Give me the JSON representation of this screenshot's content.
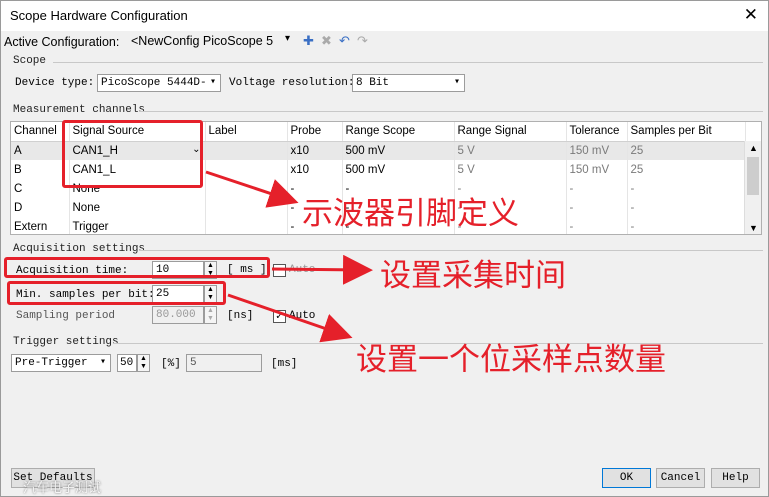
{
  "window": {
    "title": "Scope Hardware Configuration",
    "close": "✕"
  },
  "active_config": {
    "label": "Active Configuration:",
    "value": "<NewConfig PicoScope 5"
  },
  "scope": {
    "group": "Scope",
    "device_type_label": "Device type:",
    "device_type_value": "PicoScope  5444D-",
    "voltage_res_label": "Voltage resolution:",
    "voltage_res_value": "8 Bit"
  },
  "channels": {
    "group": "Measurement channels",
    "headers": [
      "Channel",
      "Signal Source",
      "Label",
      "Probe",
      "Range Scope",
      "Range Signal",
      "Tolerance",
      "Samples per Bit"
    ],
    "rows": [
      [
        "A",
        "CAN1_H",
        "",
        "x10",
        "500 mV",
        "5 V",
        "150 mV",
        "25"
      ],
      [
        "B",
        "CAN1_L",
        "",
        "x10",
        "500 mV",
        "5 V",
        "150 mV",
        "25"
      ],
      [
        "C",
        "None",
        "",
        "-",
        "-",
        "-",
        "-",
        "-"
      ],
      [
        "D",
        "None",
        "",
        "-",
        "-",
        "-",
        "-",
        "-"
      ],
      [
        "Extern",
        "Trigger",
        "",
        "-",
        "-",
        "-",
        "-",
        "-"
      ]
    ]
  },
  "acquisition": {
    "group": "Acquisition settings",
    "time_label": "Acquisition time:",
    "time_value": "10",
    "time_unit": "[ ms ]",
    "auto1": "Auto",
    "min_samples_label": "Min. samples per bit:",
    "min_samples_value": "25",
    "sampling_label": "Sampling period",
    "sampling_value": "80.000",
    "sampling_unit": "[ns]",
    "auto2": "Auto"
  },
  "trigger": {
    "group": "Trigger settings",
    "mode": "Pre-Trigger",
    "percent": "50",
    "percent_unit": "[%]",
    "ms_value": "5",
    "ms_unit": "[ms]"
  },
  "buttons": {
    "defaults": "Set Defaults",
    "ok": "OK",
    "cancel": "Cancel",
    "help": "Help"
  },
  "annotations": {
    "a1": "示波器引脚定义",
    "a2": "设置采集时间",
    "a3": "设置一个位采样点数量"
  },
  "watermark": "汽车电子测试",
  "colors": {
    "annotation": "#e5202a",
    "accent": "#0078d7"
  }
}
